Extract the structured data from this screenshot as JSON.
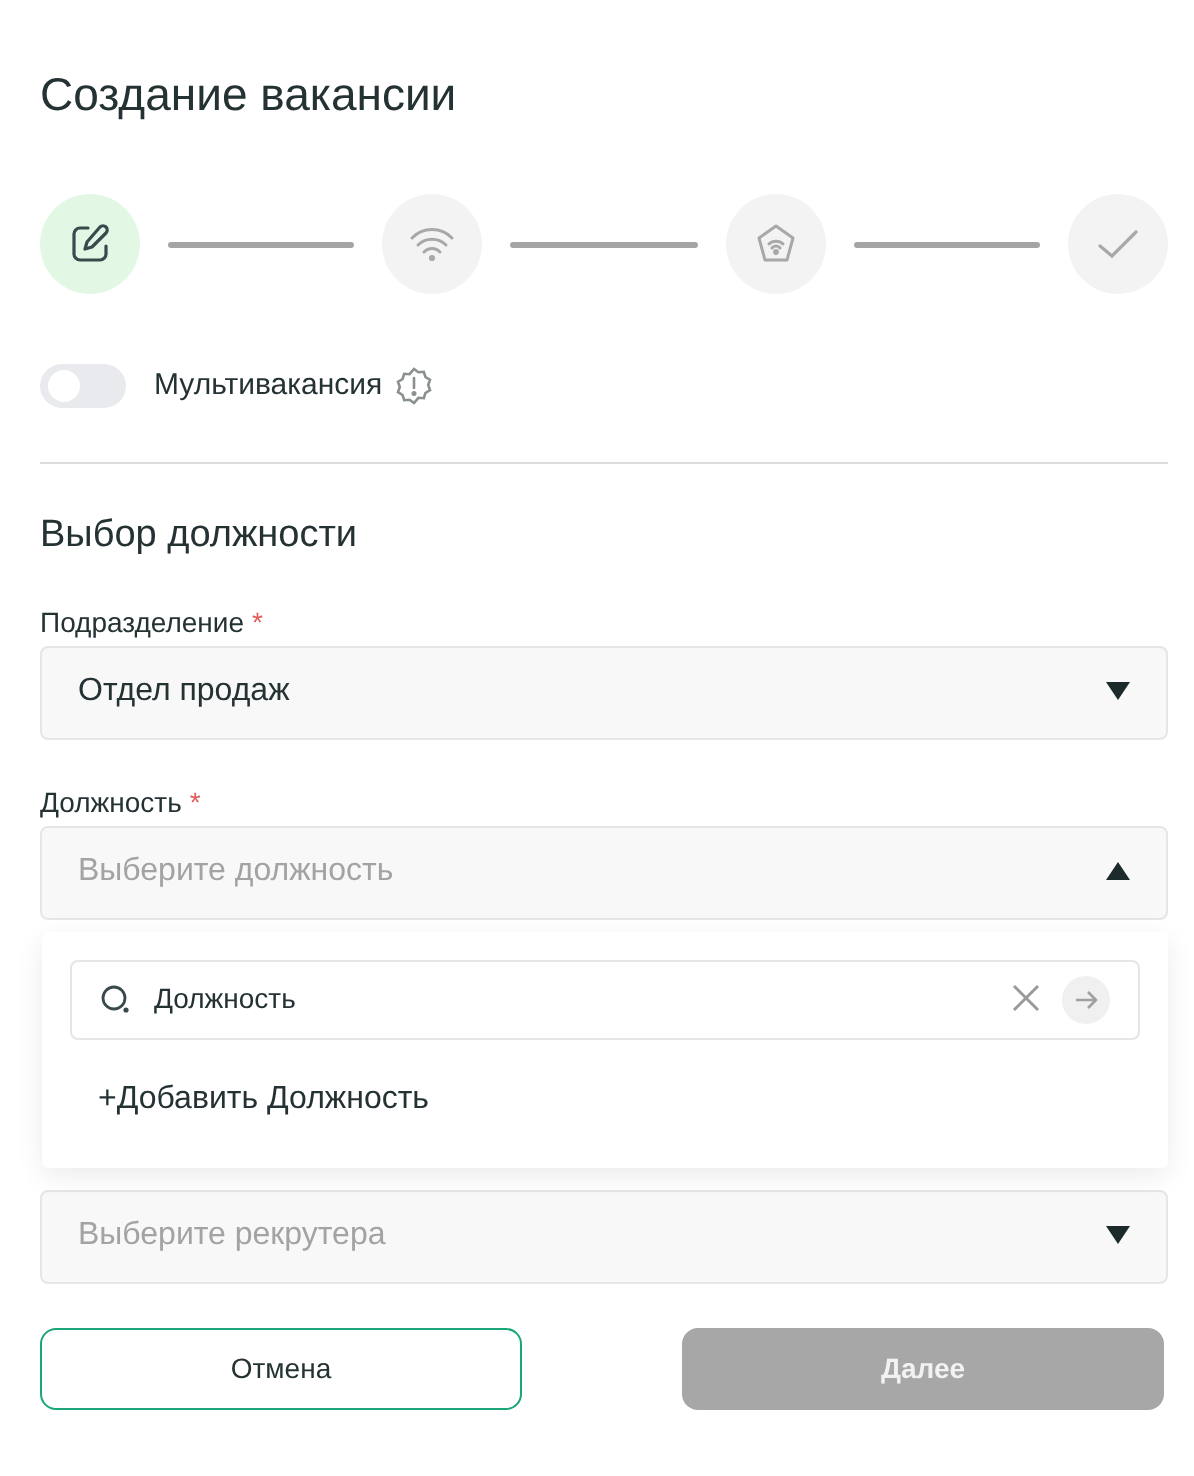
{
  "title": "Создание вакансии",
  "steps": [
    {
      "kind": "edit",
      "active": true
    },
    {
      "kind": "wifi",
      "active": false
    },
    {
      "kind": "home",
      "active": false
    },
    {
      "kind": "check",
      "active": false
    }
  ],
  "multivacancy": {
    "label": "Мультивакансия",
    "on": false
  },
  "section_title": "Выбор должности",
  "fields": [
    {
      "label": "Подразделение",
      "required_mark": "*",
      "value": "Отдел продаж",
      "expanded": false
    },
    {
      "label": "Должность",
      "required_mark": "*",
      "placeholder": "Выберите должность",
      "expanded": true,
      "dropdown": {
        "search_value": "Должность",
        "add_item": "+Добавить Должность"
      }
    },
    {
      "placeholder": "Выберите рекрутера",
      "expanded": false
    }
  ],
  "buttons": [
    {
      "label": "Отмена",
      "kind": "outline",
      "disabled": false
    },
    {
      "label": "Далее",
      "kind": "primary",
      "disabled": true
    }
  ]
}
